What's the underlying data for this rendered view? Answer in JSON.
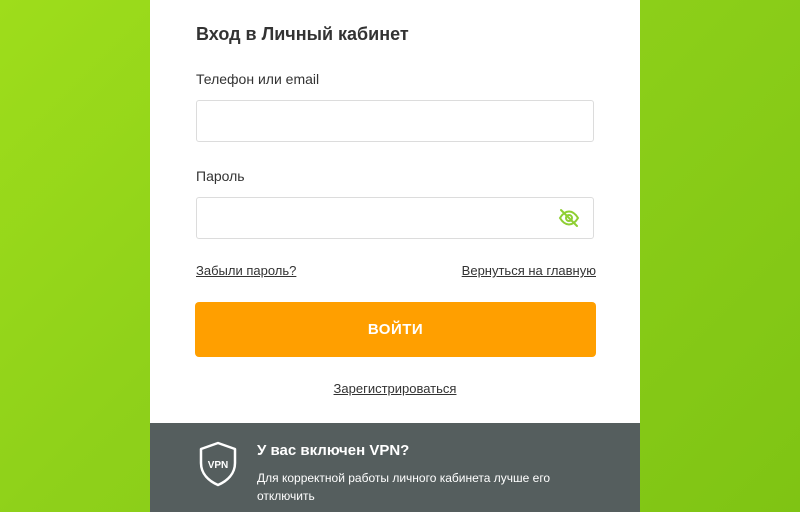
{
  "login_form": {
    "title": "Вход в Личный кабинет",
    "login_label": "Телефон или email",
    "login_value": "",
    "password_label": "Пароль",
    "password_value": "",
    "password_toggle_icon": "eye-off-icon",
    "forgot_link": "Забыли пароль?",
    "home_link": "Вернуться на главную",
    "submit_label": "ВОЙТИ",
    "register_link": "Зарегистрироваться"
  },
  "vpn_notice": {
    "icon": "vpn-shield-icon",
    "icon_text": "VPN",
    "title": "У вас включен VPN?",
    "text": "Для корректной работы личного кабинета лучше его отключить"
  },
  "colors": {
    "background": "#8fd11a",
    "button": "#ff9f00",
    "notice_bg": "#555e5e",
    "eye_icon": "#8fcf33"
  }
}
